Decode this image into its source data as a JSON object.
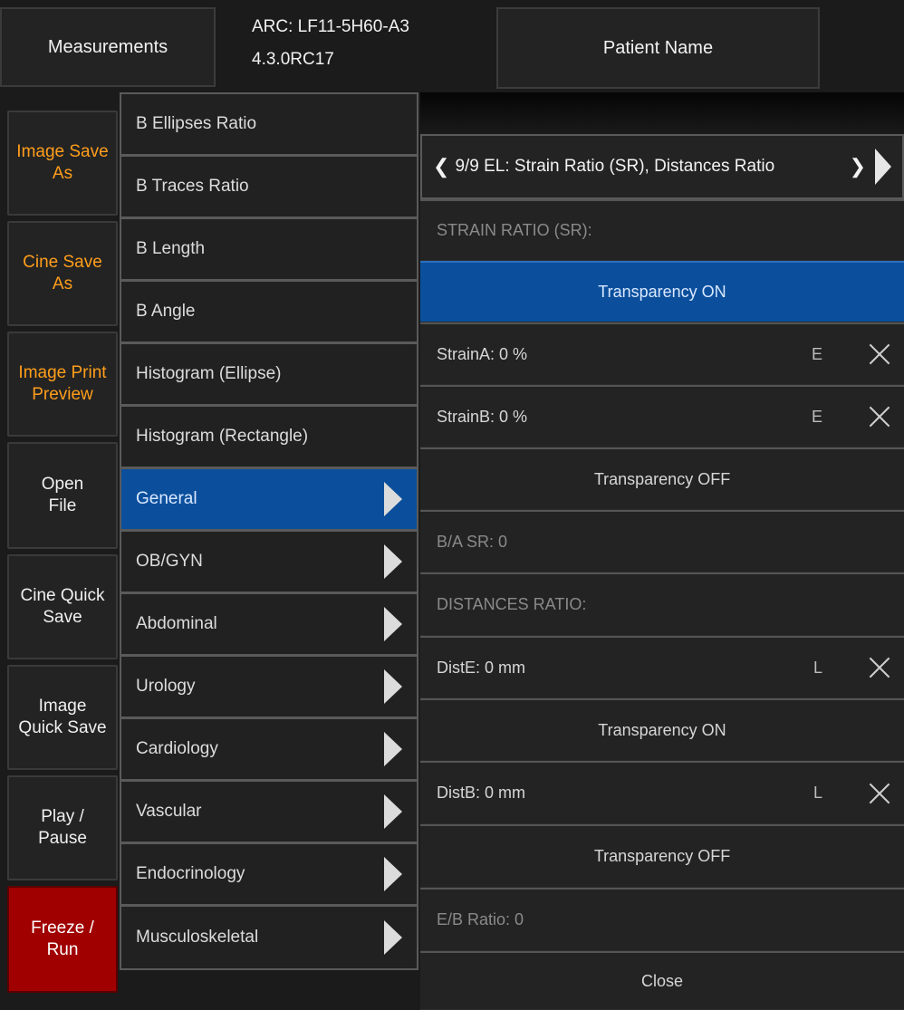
{
  "header": {
    "measurements_label": "Measurements",
    "arc_line1": "ARC: LF11-5H60-A3",
    "arc_line2": "4.3.0RC17",
    "patient_label": "Patient Name"
  },
  "left_buttons": [
    {
      "label": "Image Save\nAs"
    },
    {
      "label": "Cine Save\nAs"
    },
    {
      "label": "Image Print\nPreview"
    },
    {
      "label": "Open\nFile"
    },
    {
      "label": "Cine Quick\nSave"
    },
    {
      "label": "Image\nQuick Save"
    },
    {
      "label": "Play /\nPause"
    },
    {
      "label": "Freeze /\nRun"
    }
  ],
  "menu": [
    {
      "label": "B Ellipses Ratio"
    },
    {
      "label": "B Traces Ratio"
    },
    {
      "label": "B Length"
    },
    {
      "label": "B Angle"
    },
    {
      "label": "Histogram (Ellipse)"
    },
    {
      "label": "Histogram (Rectangle)"
    },
    {
      "label": "General"
    },
    {
      "label": "OB/GYN"
    },
    {
      "label": "Abdominal"
    },
    {
      "label": "Urology"
    },
    {
      "label": "Cardiology"
    },
    {
      "label": "Vascular"
    },
    {
      "label": "Endocrinology"
    },
    {
      "label": "Musculoskeletal"
    }
  ],
  "panel": {
    "nav_title": "9/9 EL: Strain Ratio (SR), Distances Ratio",
    "strain_heading": "STRAIN RATIO (SR):",
    "transparency_on_1": "Transparency ON",
    "strain_a": "StrainA: 0 %",
    "strain_a_unit": "E",
    "strain_b": "StrainB: 0 %",
    "strain_b_unit": "E",
    "transparency_off_1": "Transparency OFF",
    "ba_sr": "B/A SR: 0",
    "distances_heading": "DISTANCES RATIO:",
    "dist_e": "DistE: 0 mm",
    "dist_e_unit": "L",
    "transparency_on_2": "Transparency ON",
    "dist_b": "DistB: 0 mm",
    "dist_b_unit": "L",
    "transparency_off_2": "Transparency OFF",
    "eb_ratio": "E/B Ratio: 0",
    "close_label": "Close"
  }
}
